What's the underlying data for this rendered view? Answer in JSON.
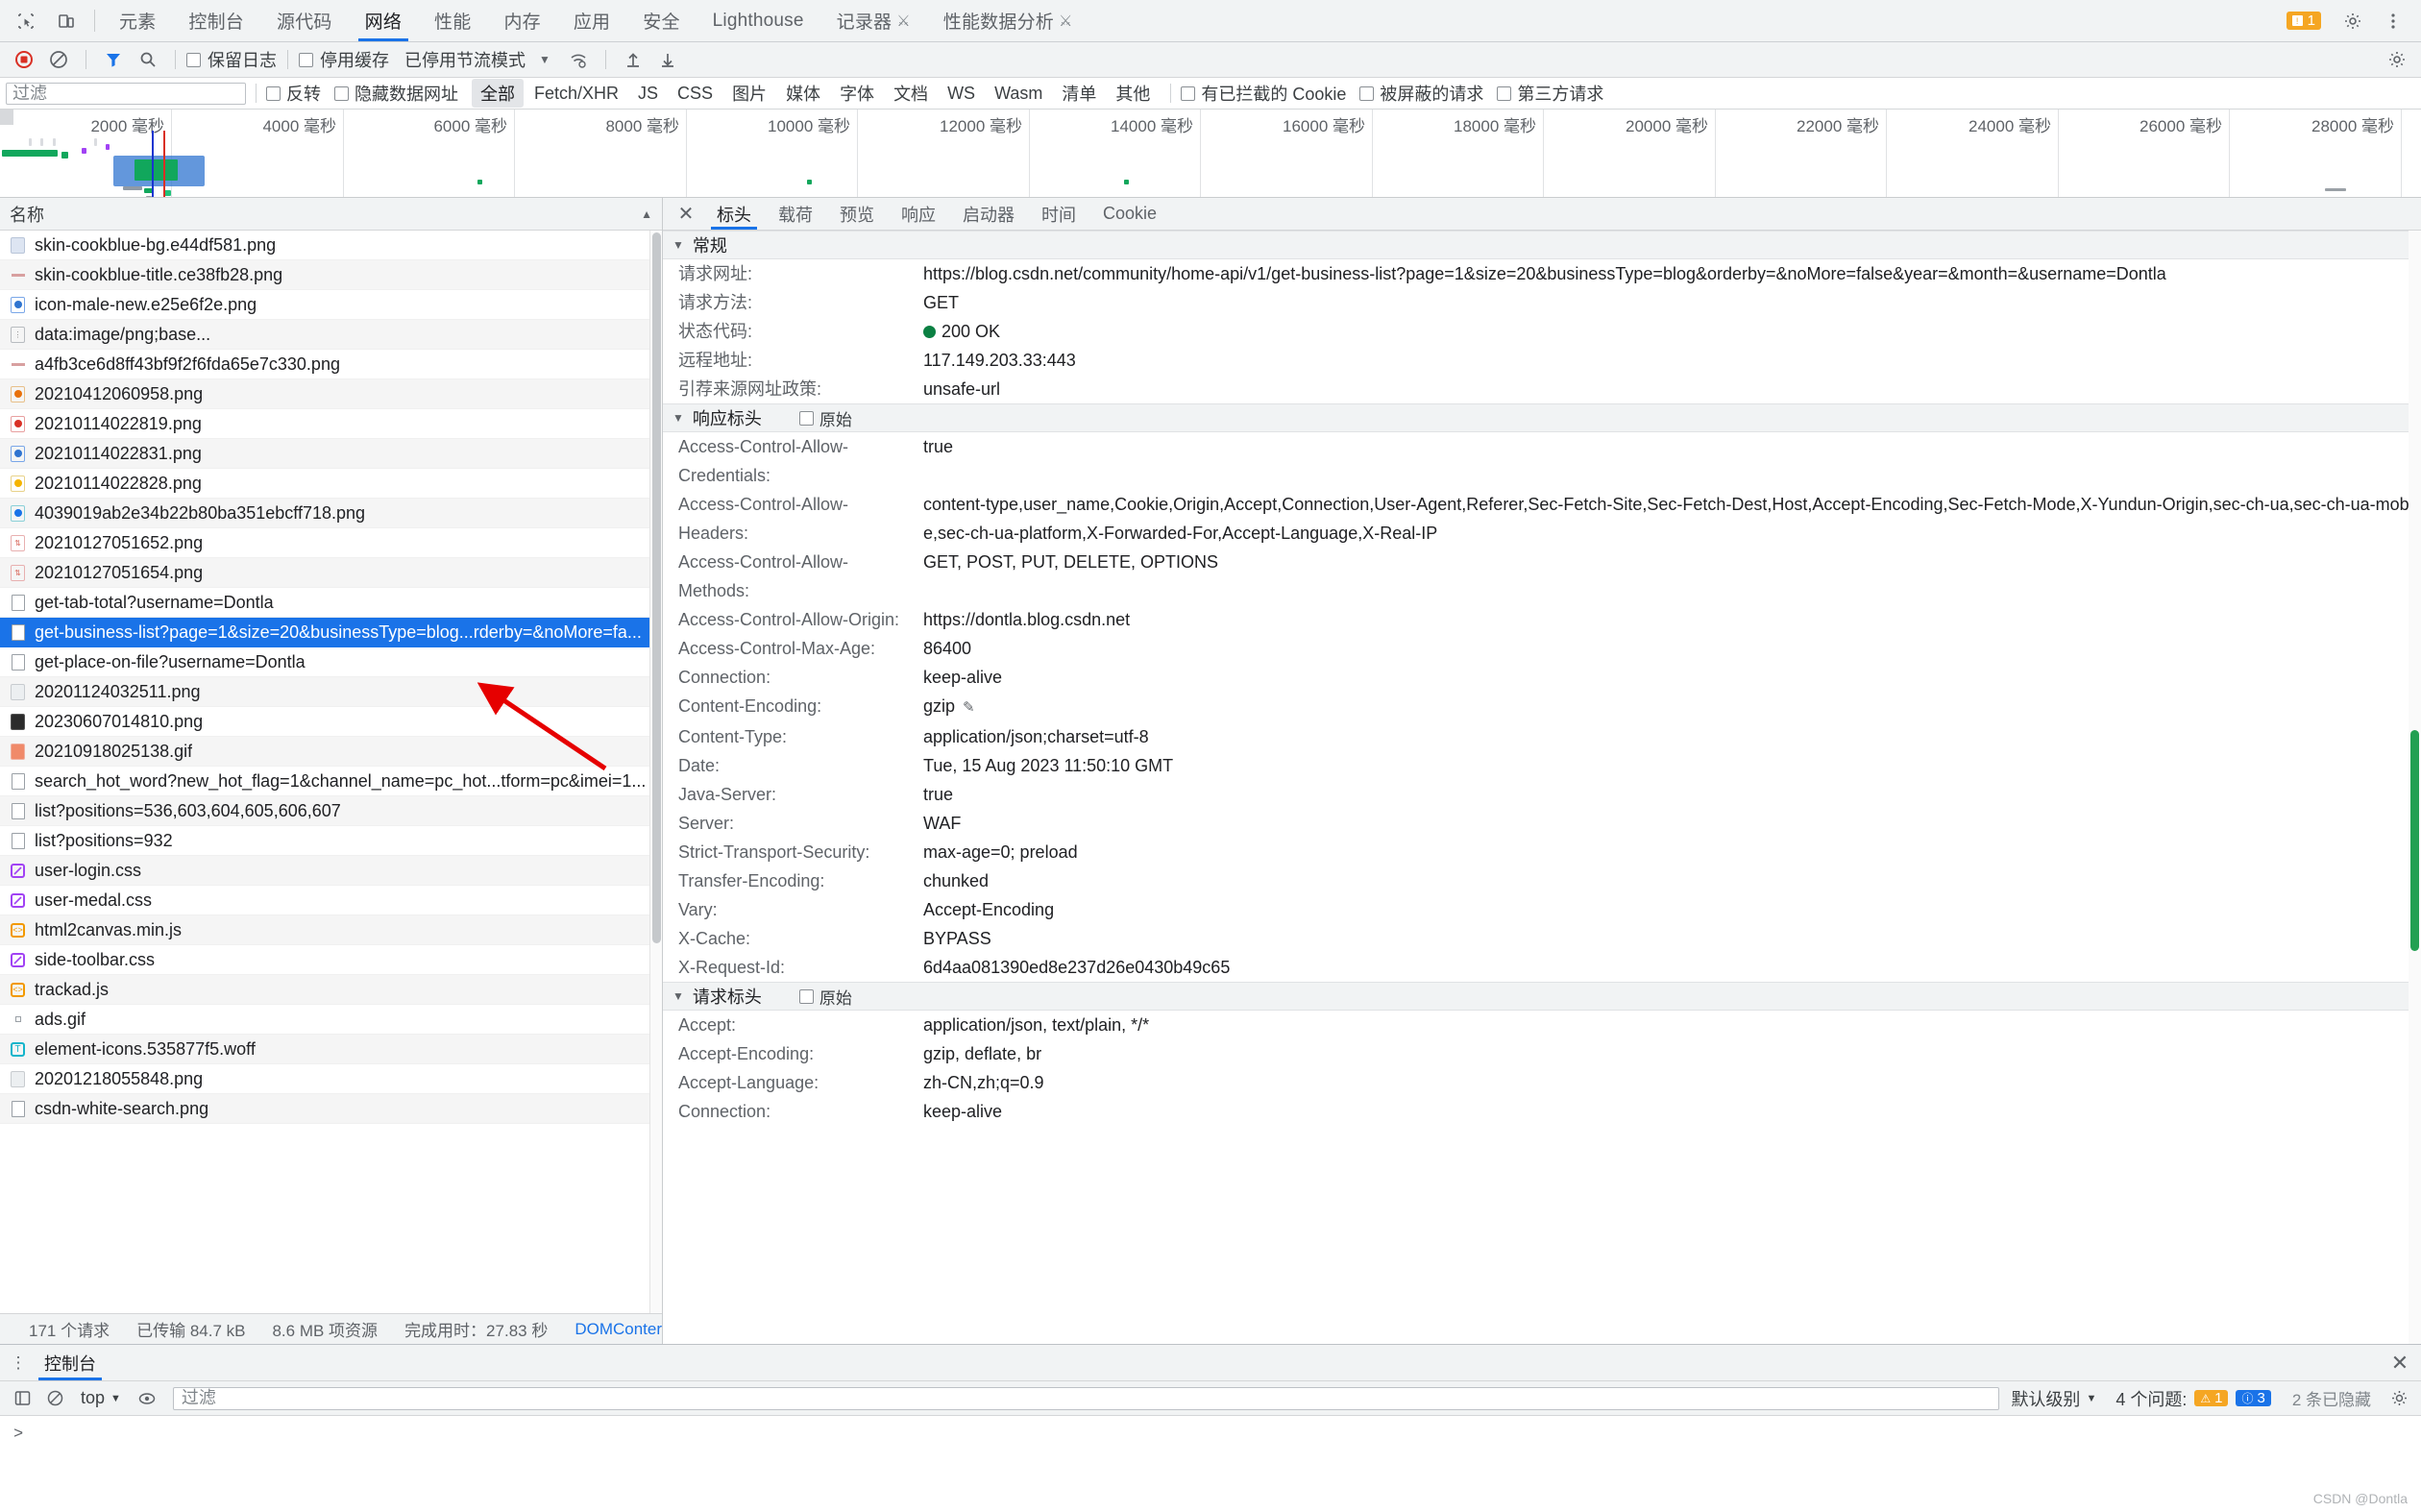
{
  "topbar": {
    "icons": [
      "inspect-icon",
      "device-toggle-icon"
    ],
    "tabs": [
      {
        "label": "元素",
        "active": false,
        "flask": false
      },
      {
        "label": "控制台",
        "active": false,
        "flask": false
      },
      {
        "label": "源代码",
        "active": false,
        "flask": false
      },
      {
        "label": "网络",
        "active": true,
        "flask": false
      },
      {
        "label": "性能",
        "active": false,
        "flask": false
      },
      {
        "label": "内存",
        "active": false,
        "flask": false
      },
      {
        "label": "应用",
        "active": false,
        "flask": false
      },
      {
        "label": "安全",
        "active": false,
        "flask": false
      },
      {
        "label": "Lighthouse",
        "active": false,
        "flask": false
      },
      {
        "label": "记录器",
        "active": false,
        "flask": true
      },
      {
        "label": "性能数据分析",
        "active": false,
        "flask": true
      }
    ],
    "issues_count": "1",
    "settings_icon": "gear-icon",
    "more_icon": "more-vertical-icon"
  },
  "network_toolbar": {
    "record_icon": "record-stop-icon",
    "clear_icon": "clear-icon",
    "filter_icon": "funnel-icon",
    "search_icon": "search-icon",
    "preserve_log": "保留日志",
    "disable_cache": "停用缓存",
    "throttling": "已停用节流模式",
    "wifi_icon": "network-conditions-icon",
    "import_icon": "import-har-icon",
    "export_icon": "export-har-icon",
    "settings_icon": "settings-gear-icon"
  },
  "filter_bar": {
    "placeholder": "过滤",
    "value": "",
    "invert": "反转",
    "hide_data_urls": "隐藏数据网址",
    "types": [
      {
        "label": "全部",
        "selected": true
      },
      {
        "label": "Fetch/XHR",
        "selected": false
      },
      {
        "label": "JS",
        "selected": false
      },
      {
        "label": "CSS",
        "selected": false
      },
      {
        "label": "图片",
        "selected": false
      },
      {
        "label": "媒体",
        "selected": false
      },
      {
        "label": "字体",
        "selected": false
      },
      {
        "label": "文档",
        "selected": false
      },
      {
        "label": "WS",
        "selected": false
      },
      {
        "label": "Wasm",
        "selected": false
      },
      {
        "label": "清单",
        "selected": false
      },
      {
        "label": "其他",
        "selected": false
      }
    ],
    "blocked_cookies": "有已拦截的 Cookie",
    "blocked_requests": "被屏蔽的请求",
    "third_party": "第三方请求"
  },
  "overview": {
    "ticks": [
      "2000 毫秒",
      "4000 毫秒",
      "6000 毫秒",
      "8000 毫秒",
      "10000 毫秒",
      "12000 毫秒",
      "14000 毫秒",
      "16000 毫秒",
      "18000 毫秒",
      "20000 毫秒",
      "22000 毫秒",
      "24000 毫秒",
      "26000 毫秒",
      "28000 毫秒"
    ]
  },
  "request_list": {
    "column_header": "名称",
    "rows": [
      {
        "name": "skin-cookblue-bg.e44df581.png",
        "icon": "image-file-icon",
        "type": "img-light",
        "selected": false
      },
      {
        "name": "skin-cookblue-title.ce38fb28.png",
        "icon": "image-file-icon",
        "type": "dash",
        "selected": false
      },
      {
        "name": "icon-male-new.e25e6f2e.png",
        "icon": "image-file-icon",
        "type": "img-blue",
        "selected": false
      },
      {
        "name": "data:image/png;base...",
        "icon": "image-file-icon",
        "type": "img-dots",
        "selected": false
      },
      {
        "name": "a4fb3ce6d8ff43bf9f2f6fda65e7c330.png",
        "icon": "image-file-icon",
        "type": "dash",
        "selected": false
      },
      {
        "name": "20210412060958.png",
        "icon": "image-file-icon",
        "type": "img-orange",
        "selected": false
      },
      {
        "name": "20210114022819.png",
        "icon": "image-file-icon",
        "type": "img-red",
        "selected": false
      },
      {
        "name": "20210114022831.png",
        "icon": "image-file-icon",
        "type": "img-blue",
        "selected": false
      },
      {
        "name": "20210114022828.png",
        "icon": "image-file-icon",
        "type": "img-yellow",
        "selected": false
      },
      {
        "name": "4039019ab2e34b22b80ba351ebcff718.png",
        "icon": "image-file-icon",
        "type": "img-teal",
        "selected": false
      },
      {
        "name": "20210127051652.png",
        "icon": "image-file-icon",
        "type": "img-pink",
        "selected": false
      },
      {
        "name": "20210127051654.png",
        "icon": "image-file-icon",
        "type": "img-pink",
        "selected": false
      },
      {
        "name": "get-tab-total?username=Dontla",
        "icon": "document-file-icon",
        "type": "doc",
        "selected": false
      },
      {
        "name": "get-business-list?page=1&size=20&businessType=blog...rderby=&noMore=fa...",
        "icon": "document-file-icon",
        "type": "doc",
        "selected": true
      },
      {
        "name": "get-place-on-file?username=Dontla",
        "icon": "document-file-icon",
        "type": "doc",
        "selected": false
      },
      {
        "name": "20201124032511.png",
        "icon": "image-file-icon",
        "type": "img-strip",
        "selected": false
      },
      {
        "name": "20230607014810.png",
        "icon": "image-file-icon",
        "type": "img-dark",
        "selected": false
      },
      {
        "name": "20210918025138.gif",
        "icon": "image-file-icon",
        "type": "img-gif",
        "selected": false
      },
      {
        "name": "search_hot_word?new_hot_flag=1&channel_name=pc_hot...tform=pc&imei=1...",
        "icon": "document-file-icon",
        "type": "doc",
        "selected": false
      },
      {
        "name": "list?positions=536,603,604,605,606,607",
        "icon": "document-file-icon",
        "type": "doc",
        "selected": false
      },
      {
        "name": "list?positions=932",
        "icon": "document-file-icon",
        "type": "doc",
        "selected": false
      },
      {
        "name": "user-login.css",
        "icon": "css-file-icon",
        "type": "css",
        "selected": false
      },
      {
        "name": "user-medal.css",
        "icon": "css-file-icon",
        "type": "css",
        "selected": false
      },
      {
        "name": "html2canvas.min.js",
        "icon": "js-file-icon",
        "type": "js",
        "selected": false
      },
      {
        "name": "side-toolbar.css",
        "icon": "css-file-icon",
        "type": "css",
        "selected": false
      },
      {
        "name": "trackad.js",
        "icon": "js-file-icon",
        "type": "js",
        "selected": false
      },
      {
        "name": "ads.gif",
        "icon": "image-file-icon",
        "type": "tiny",
        "selected": false
      },
      {
        "name": "element-icons.535877f5.woff",
        "icon": "font-file-icon",
        "type": "font",
        "selected": false
      },
      {
        "name": "20201218055848.png",
        "icon": "image-file-icon",
        "type": "img-strip",
        "selected": false
      },
      {
        "name": "csdn-white-search.png",
        "icon": "document-file-icon",
        "type": "doc",
        "selected": false
      }
    ],
    "status": {
      "requests": "171 个请求",
      "transferred": "已传输 84.7 kB",
      "resources": "8.6 MB 项资源",
      "finish": "完成用时：27.83 秒",
      "domcontent": "DOMConter"
    }
  },
  "details": {
    "close_icon": "close-icon",
    "tabs": [
      {
        "label": "标头",
        "active": true
      },
      {
        "label": "载荷",
        "active": false
      },
      {
        "label": "预览",
        "active": false
      },
      {
        "label": "响应",
        "active": false
      },
      {
        "label": "启动器",
        "active": false
      },
      {
        "label": "时间",
        "active": false
      },
      {
        "label": "Cookie",
        "active": false
      }
    ],
    "general": {
      "title": "常规",
      "rows": [
        {
          "key": "请求网址:",
          "value": "https://blog.csdn.net/community/home-api/v1/get-business-list?page=1&size=20&businessType=blog&orderby=&noMore=false&year=&month=&username=Dontla"
        },
        {
          "key": "请求方法:",
          "value": "GET"
        },
        {
          "key": "状态代码:",
          "value": "200 OK",
          "status_dot": true
        },
        {
          "key": "远程地址:",
          "value": "117.149.203.33:443"
        },
        {
          "key": "引荐来源网址政策:",
          "value": "unsafe-url"
        }
      ]
    },
    "response_headers": {
      "title": "响应标头",
      "raw_label": "原始",
      "rows": [
        {
          "key": "Access-Control-Allow-Credentials:",
          "value": "true"
        },
        {
          "key": "Access-Control-Allow-Headers:",
          "value": "content-type,user_name,Cookie,Origin,Accept,Connection,User-Agent,Referer,Sec-Fetch-Site,Sec-Fetch-Dest,Host,Accept-Encoding,Sec-Fetch-Mode,X-Yundun-Origin,sec-ch-ua,sec-ch-ua-mobile,sec-ch-ua-platform,X-Forwarded-For,Accept-Language,X-Real-IP"
        },
        {
          "key": "Access-Control-Allow-Methods:",
          "value": "GET, POST, PUT, DELETE, OPTIONS"
        },
        {
          "key": "Access-Control-Allow-Origin:",
          "value": "https://dontla.blog.csdn.net"
        },
        {
          "key": "Access-Control-Max-Age:",
          "value": "86400"
        },
        {
          "key": "Connection:",
          "value": "keep-alive"
        },
        {
          "key": "Content-Encoding:",
          "value": "gzip",
          "pencil": true
        },
        {
          "key": "Content-Type:",
          "value": "application/json;charset=utf-8"
        },
        {
          "key": "Date:",
          "value": "Tue, 15 Aug 2023 11:50:10 GMT"
        },
        {
          "key": "Java-Server:",
          "value": "true"
        },
        {
          "key": "Server:",
          "value": "WAF"
        },
        {
          "key": "Strict-Transport-Security:",
          "value": "max-age=0; preload"
        },
        {
          "key": "Transfer-Encoding:",
          "value": "chunked"
        },
        {
          "key": "Vary:",
          "value": "Accept-Encoding"
        },
        {
          "key": "X-Cache:",
          "value": "BYPASS"
        },
        {
          "key": "X-Request-Id:",
          "value": "6d4aa081390ed8e237d26e0430b49c65"
        }
      ]
    },
    "request_headers": {
      "title": "请求标头",
      "raw_label": "原始",
      "rows": [
        {
          "key": "Accept:",
          "value": "application/json, text/plain, */*"
        },
        {
          "key": "Accept-Encoding:",
          "value": "gzip, deflate, br"
        },
        {
          "key": "Accept-Language:",
          "value": "zh-CN,zh;q=0.9"
        },
        {
          "key": "Connection:",
          "value": "keep-alive"
        }
      ]
    }
  },
  "drawer": {
    "more_icon": "more-vertical-icon",
    "tab_label": "控制台",
    "close_icon": "close-icon",
    "clear_icon": "clear-console-icon",
    "no_icon": "ban-icon",
    "context": "top",
    "eye_icon": "live-expression-icon",
    "filter_placeholder": "过滤",
    "filter_value": "",
    "level": "默认级别",
    "issues_label": "4 个问题:",
    "warn_count": "1",
    "info_count": "3",
    "hidden_label": "2 条已隐藏",
    "settings_icon": "gear-icon",
    "prompt": ">"
  },
  "watermark": "CSDN @Dontla",
  "colors": {
    "accent": "#1a73e8",
    "toolbar_bg": "#f1f3f4",
    "status_ok": "#0b8043",
    "arrow_red": "#e60000",
    "warn": "#f5a623"
  }
}
